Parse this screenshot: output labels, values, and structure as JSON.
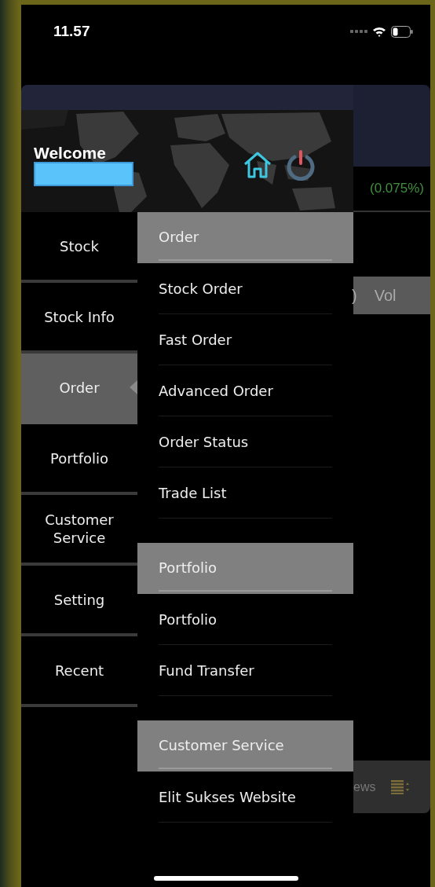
{
  "status_bar": {
    "time": "11.57"
  },
  "drawer": {
    "welcome": "Welcome",
    "menu": [
      {
        "label": "Stock",
        "selected": false
      },
      {
        "label": "Stock Info",
        "selected": false
      },
      {
        "label": "Order",
        "selected": true
      },
      {
        "label": "Portfolio",
        "selected": false
      },
      {
        "label": "Customer Service",
        "selected": false
      },
      {
        "label": "Setting",
        "selected": false
      },
      {
        "label": "Recent",
        "selected": false
      }
    ],
    "submenu": [
      {
        "title": "Order",
        "items": [
          "Stock Order",
          "Fast Order",
          "Advanced Order",
          "Order Status",
          "Trade List"
        ]
      },
      {
        "title": "Portfolio",
        "items": [
          "Portfolio",
          "Fund Transfer"
        ]
      },
      {
        "title": "Customer Service",
        "items": [
          "Elit Sukses Website"
        ]
      }
    ]
  },
  "background": {
    "change": "(0.075%)",
    "column_paren": ")",
    "column_vol": "Vol",
    "tab_news": "ews"
  }
}
